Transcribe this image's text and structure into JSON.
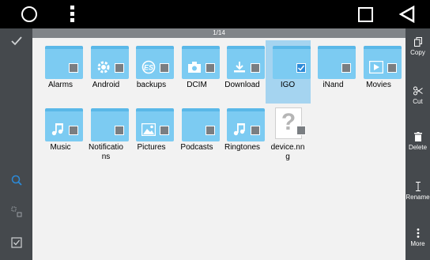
{
  "pager": {
    "text": "1/14"
  },
  "right_actions": [
    {
      "label": "Copy",
      "icon": "copy-icon"
    },
    {
      "label": "Cut",
      "icon": "scissors-icon"
    },
    {
      "label": "Delete",
      "icon": "trash-icon"
    },
    {
      "label": "Rename",
      "icon": "text-cursor-icon"
    },
    {
      "label": "More",
      "icon": "more-vertical-icon"
    }
  ],
  "left_icons": [
    "checkmark-icon",
    "search-icon",
    "select-partial-icon",
    "select-all-icon"
  ],
  "items": [
    {
      "label": "Alarms",
      "type": "folder",
      "emblem": ""
    },
    {
      "label": "Android",
      "type": "folder",
      "emblem": "gear"
    },
    {
      "label": "backups",
      "type": "folder",
      "emblem": "es"
    },
    {
      "label": "DCIM",
      "type": "folder",
      "emblem": "camera"
    },
    {
      "label": "Download",
      "type": "folder",
      "emblem": "download"
    },
    {
      "label": "IGO",
      "type": "folder",
      "emblem": "",
      "selected": true
    },
    {
      "label": "iNand",
      "type": "folder",
      "emblem": ""
    },
    {
      "label": "Movies",
      "type": "folder",
      "emblem": "play"
    },
    {
      "label": "Music",
      "type": "folder",
      "emblem": "music"
    },
    {
      "label": "Notificatio\nns",
      "type": "folder",
      "emblem": ""
    },
    {
      "label": "Pictures",
      "type": "folder",
      "emblem": "image"
    },
    {
      "label": "Podcasts",
      "type": "folder",
      "emblem": ""
    },
    {
      "label": "Ringtones",
      "type": "folder",
      "emblem": "music"
    },
    {
      "label": "device.nn\ng",
      "type": "file",
      "emblem": "question"
    }
  ],
  "colors": {
    "accent": "#2c8ad8",
    "folder": "#7ccbf2",
    "selected_bg": "#a5d4f0"
  }
}
